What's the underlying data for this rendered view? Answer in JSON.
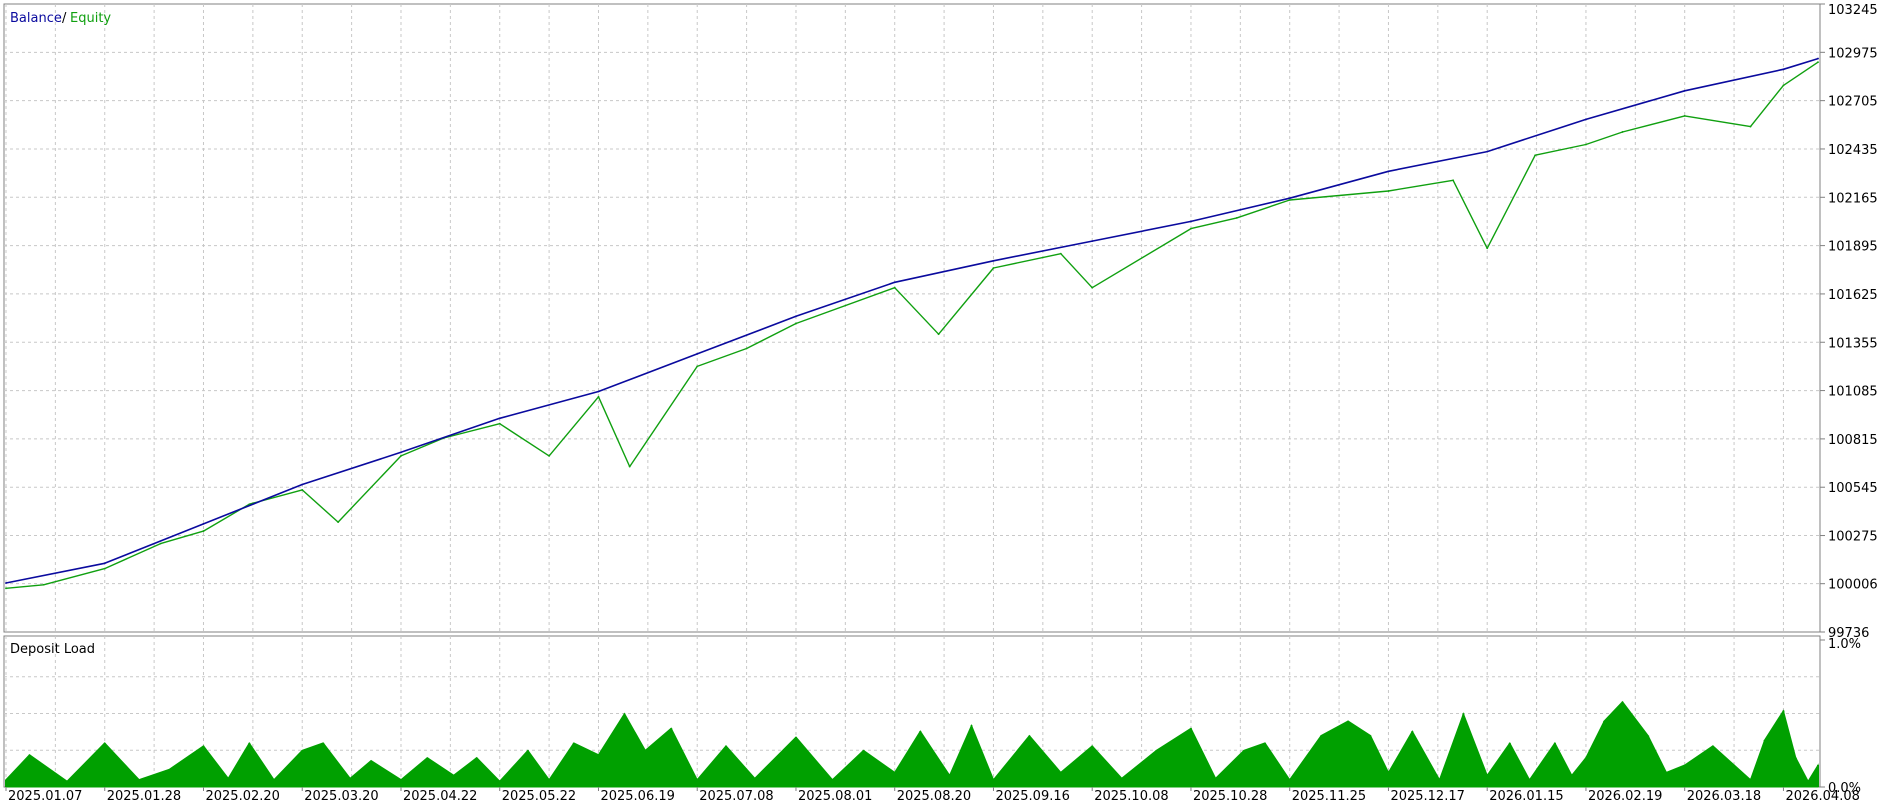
{
  "chart_data": [
    {
      "type": "line",
      "panel": "balance-equity",
      "title": "",
      "xlabel": "",
      "ylabel": "",
      "ylim": [
        99736,
        103245
      ],
      "y_ticks": [
        103245,
        102975,
        102705,
        102435,
        102165,
        101895,
        101625,
        101355,
        101085,
        100815,
        100545,
        100275,
        100006,
        99736
      ],
      "x_ticks": [
        "2025.01.07",
        "2025.01.28",
        "2025.02.20",
        "2025.03.20",
        "2025.04.22",
        "2025.05.22",
        "2025.06.19",
        "2025.07.08",
        "2025.08.01",
        "2025.08.20",
        "2025.09.16",
        "2025.10.08",
        "2025.10.28",
        "2025.11.25",
        "2025.12.17",
        "2026.01.15",
        "2026.02.19",
        "2026.03.18",
        "2026.04.08"
      ],
      "grid": true,
      "legend": {
        "placement": "top-left",
        "entries": [
          {
            "name": "Balance",
            "color": "#0a0a9e"
          },
          {
            "name": "Equity",
            "color": "#10a010"
          }
        ],
        "separator": "/"
      },
      "series": [
        {
          "name": "Balance",
          "color": "#0a0a9e",
          "x": [
            "2025.01.07",
            "2025.01.28",
            "2025.02.20",
            "2025.03.20",
            "2025.04.22",
            "2025.05.22",
            "2025.06.19",
            "2025.07.08",
            "2025.08.01",
            "2025.08.20",
            "2025.09.16",
            "2025.10.08",
            "2025.10.28",
            "2025.11.25",
            "2025.12.17",
            "2026.01.15",
            "2026.02.19",
            "2026.03.18",
            "2026.04.08",
            "2026.04.22"
          ],
          "values": [
            100010,
            100120,
            100340,
            100560,
            100740,
            100930,
            101080,
            101290,
            101500,
            101690,
            101810,
            101920,
            102030,
            102160,
            102310,
            102420,
            102600,
            102760,
            102880,
            102940
          ]
        },
        {
          "name": "Equity",
          "color": "#10a010",
          "x": [
            "2025.01.07",
            "2025.01.15",
            "2025.01.28",
            "2025.02.10",
            "2025.02.20",
            "2025.03.05",
            "2025.03.20",
            "2025.04.01",
            "2025.04.22",
            "2025.05.05",
            "2025.05.22",
            "2025.06.05",
            "2025.06.19",
            "2025.06.25",
            "2025.07.08",
            "2025.07.20",
            "2025.08.01",
            "2025.08.20",
            "2025.09.01",
            "2025.09.16",
            "2025.10.01",
            "2025.10.08",
            "2025.10.28",
            "2025.11.10",
            "2025.11.25",
            "2025.12.17",
            "2026.01.05",
            "2026.01.15",
            "2026.02.01",
            "2026.02.19",
            "2026.03.01",
            "2026.03.18",
            "2026.04.01",
            "2026.04.08",
            "2026.04.22"
          ],
          "values": [
            99980,
            100000,
            100090,
            100230,
            100300,
            100450,
            100530,
            100350,
            100720,
            100820,
            100900,
            100720,
            101050,
            100660,
            101220,
            101320,
            101460,
            101660,
            101400,
            101770,
            101850,
            101660,
            101990,
            102050,
            102150,
            102200,
            102260,
            101880,
            102400,
            102460,
            102530,
            102620,
            102560,
            102790,
            102920
          ]
        }
      ]
    },
    {
      "type": "area",
      "panel": "deposit-load",
      "title": "Deposit Load",
      "xlabel": "",
      "ylabel": "",
      "ylim": [
        0.0,
        1.0
      ],
      "y_ticks": [
        "1.0%",
        "0.0%"
      ],
      "grid": true,
      "series": [
        {
          "name": "",
          "color": "#00a000",
          "x": [
            "2025.01.07",
            "2025.01.12",
            "2025.01.20",
            "2025.01.28",
            "2025.02.05",
            "2025.02.12",
            "2025.02.20",
            "2025.02.27",
            "2025.03.05",
            "2025.03.12",
            "2025.03.20",
            "2025.03.27",
            "2025.04.05",
            "2025.04.12",
            "2025.04.22",
            "2025.04.30",
            "2025.05.08",
            "2025.05.15",
            "2025.05.22",
            "2025.05.30",
            "2025.06.05",
            "2025.06.12",
            "2025.06.19",
            "2025.06.24",
            "2025.06.28",
            "2025.07.03",
            "2025.07.08",
            "2025.07.15",
            "2025.07.22",
            "2025.08.01",
            "2025.08.08",
            "2025.08.14",
            "2025.08.20",
            "2025.08.27",
            "2025.09.04",
            "2025.09.10",
            "2025.09.16",
            "2025.09.24",
            "2025.10.01",
            "2025.10.08",
            "2025.10.14",
            "2025.10.21",
            "2025.10.28",
            "2025.11.04",
            "2025.11.12",
            "2025.11.18",
            "2025.11.25",
            "2025.12.02",
            "2025.12.08",
            "2025.12.13",
            "2025.12.17",
            "2025.12.24",
            "2026.01.01",
            "2026.01.08",
            "2026.01.15",
            "2026.01.23",
            "2026.01.30",
            "2026.02.08",
            "2026.02.14",
            "2026.02.19",
            "2026.02.24",
            "2026.03.01",
            "2026.03.08",
            "2026.03.13",
            "2026.03.18",
            "2026.03.24",
            "2026.04.01",
            "2026.04.04",
            "2026.04.08",
            "2026.04.13",
            "2026.04.18",
            "2026.04.22"
          ],
          "values": [
            0.05,
            0.22,
            0.04,
            0.3,
            0.05,
            0.12,
            0.28,
            0.06,
            0.3,
            0.05,
            0.25,
            0.3,
            0.06,
            0.18,
            0.05,
            0.2,
            0.08,
            0.2,
            0.04,
            0.25,
            0.05,
            0.3,
            0.22,
            0.5,
            0.25,
            0.4,
            0.05,
            0.28,
            0.06,
            0.34,
            0.05,
            0.25,
            0.1,
            0.38,
            0.08,
            0.42,
            0.05,
            0.35,
            0.1,
            0.28,
            0.06,
            0.25,
            0.4,
            0.06,
            0.25,
            0.3,
            0.05,
            0.35,
            0.45,
            0.35,
            0.1,
            0.38,
            0.05,
            0.5,
            0.08,
            0.3,
            0.05,
            0.3,
            0.08,
            0.2,
            0.45,
            0.58,
            0.35,
            0.1,
            0.15,
            0.28,
            0.05,
            0.32,
            0.52,
            0.2,
            0.04,
            0.15
          ]
        }
      ]
    }
  ]
}
